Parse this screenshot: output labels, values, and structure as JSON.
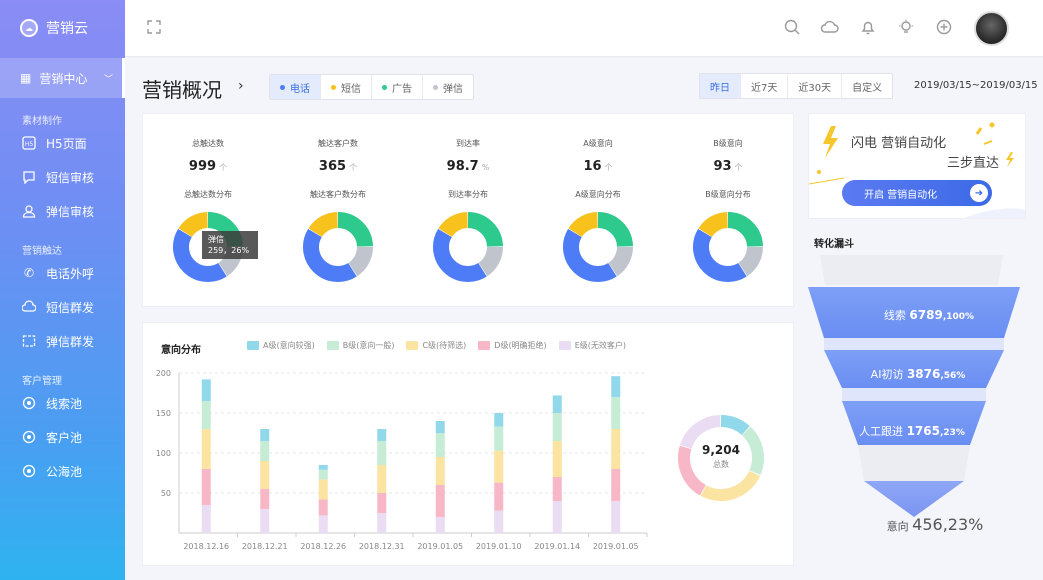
{
  "brand": {
    "name": "营销云"
  },
  "sidebar": {
    "main": "营销中心",
    "groups": [
      {
        "title": "素材制作",
        "items": [
          {
            "label": "H5页面",
            "icon": "h5-icon"
          },
          {
            "label": "短信审核",
            "icon": "sms-icon"
          },
          {
            "label": "弹信审核",
            "icon": "user-icon"
          }
        ]
      },
      {
        "title": "营销触达",
        "items": [
          {
            "label": "电话外呼",
            "icon": "phone-icon"
          },
          {
            "label": "短信群发",
            "icon": "cloud-message-icon"
          },
          {
            "label": "弹信群发",
            "icon": "popup-icon"
          }
        ]
      },
      {
        "title": "客户管理",
        "items": [
          {
            "label": "线索池",
            "icon": "target-icon"
          },
          {
            "label": "客户池",
            "icon": "target-icon"
          },
          {
            "label": "公海池",
            "icon": "target-icon"
          }
        ]
      }
    ]
  },
  "header": {
    "title": "营销概况"
  },
  "channel_tabs": [
    {
      "label": "电话",
      "color": "#4e7cf6"
    },
    {
      "label": "短信",
      "color": "#f7c21b"
    },
    {
      "label": "广告",
      "color": "#2ec98c"
    },
    {
      "label": "弹信",
      "color": "#c0c4cc"
    }
  ],
  "range_tabs": [
    "昨日",
    "近7天",
    "近30天",
    "自定义"
  ],
  "date_range": "2019/03/15~2019/03/15",
  "stats": [
    {
      "label": "总触达数",
      "value": "999",
      "unit": "个",
      "sub": "总触达数分布"
    },
    {
      "label": "触达客户数",
      "value": "365",
      "unit": "个",
      "sub": "触达客户数分布"
    },
    {
      "label": "到达率",
      "value": "98.7",
      "unit": "%",
      "sub": "到达率分布"
    },
    {
      "label": "A级意向",
      "value": "16",
      "unit": "个",
      "sub": "A级意向分布"
    },
    {
      "label": "B级意向",
      "value": "93",
      "unit": "个",
      "sub": "B级意向分布"
    }
  ],
  "tooltip": {
    "name": "弹信",
    "value": "259，26%"
  },
  "promo": {
    "line1": "闪电 营销自动化",
    "line2": "三步直达",
    "button": "开启 营销自动化"
  },
  "funnel": {
    "title": "转化漏斗",
    "stages": [
      {
        "label": "线索",
        "value": "6789",
        "pct": ",100%"
      },
      {
        "label": "AI初访",
        "value": "3876",
        "pct": ",56%"
      },
      {
        "label": "人工跟进",
        "value": "1765",
        "pct": ",23%"
      },
      {
        "label": "意向",
        "value": "456",
        "pct": ",23%"
      }
    ]
  },
  "intent": {
    "title": "意向分布",
    "total": {
      "value": "9,204",
      "label": "总数"
    }
  },
  "chart_data": {
    "type": "bar",
    "stacked": true,
    "categories": [
      "2018.12.16",
      "2018.12.21",
      "2018.12.26",
      "2018.12.31",
      "2019.01.05",
      "2019.01.10",
      "2019.01.14",
      "2019.01.05"
    ],
    "ylim": [
      0,
      200
    ],
    "yticks": [
      50,
      100,
      150,
      200
    ],
    "series": [
      {
        "name": "E级(无效客户)",
        "color": "#eadcf2",
        "values": [
          35,
          30,
          22,
          25,
          20,
          28,
          40,
          40
        ]
      },
      {
        "name": "D级(明确拒绝)",
        "color": "#f7b7c6",
        "values": [
          45,
          25,
          20,
          25,
          40,
          35,
          30,
          40
        ]
      },
      {
        "name": "C级(待筛选)",
        "color": "#fbe3a2",
        "values": [
          50,
          35,
          25,
          35,
          35,
          40,
          45,
          50
        ]
      },
      {
        "name": "B级(意向一般)",
        "color": "#c6ecd6",
        "values": [
          35,
          25,
          12,
          30,
          30,
          30,
          35,
          40
        ]
      },
      {
        "name": "A级(意向较强)",
        "color": "#90d8ea",
        "values": [
          27,
          15,
          6,
          15,
          15,
          17,
          22,
          26
        ]
      }
    ]
  }
}
